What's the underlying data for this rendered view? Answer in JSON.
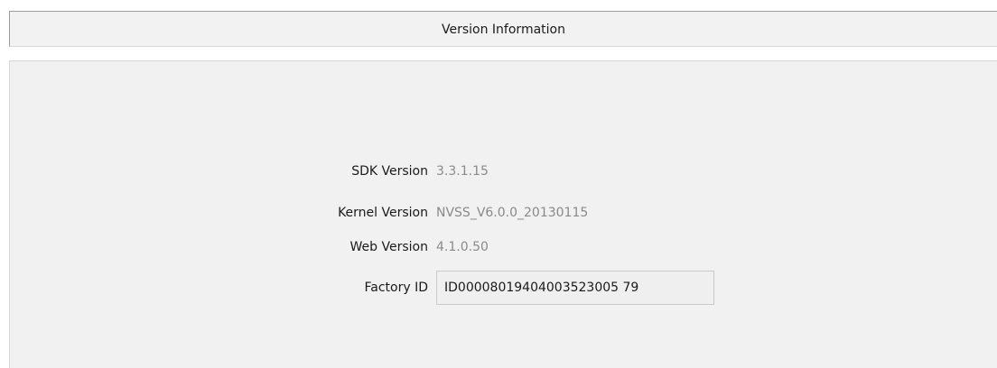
{
  "header": {
    "title": "Version Information"
  },
  "fields": {
    "sdk_version": {
      "label": "SDK Version",
      "value": "3.3.1.15"
    },
    "kernel_version": {
      "label": "Kernel Version",
      "value": "NVSS_V6.0.0_20130115"
    },
    "web_version": {
      "label": "Web Version",
      "value": "4.1.0.50"
    },
    "factory_id": {
      "label": "Factory ID",
      "value": "ID00008019404003523005 79"
    }
  }
}
